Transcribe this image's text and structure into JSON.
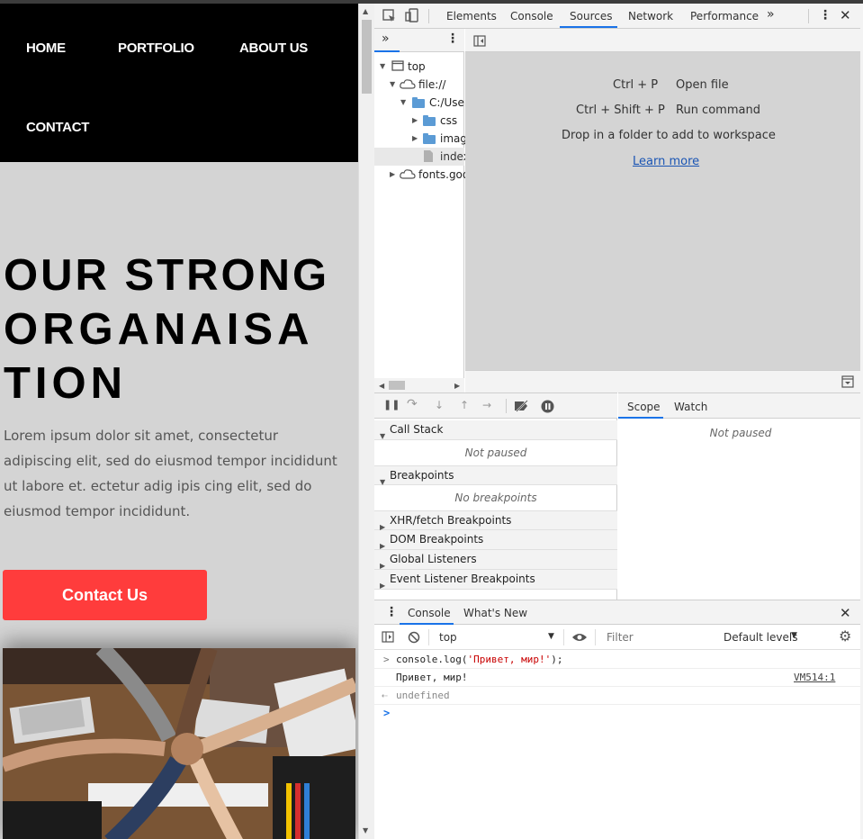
{
  "website": {
    "nav": [
      "HOME",
      "PORTFOLIO",
      "ABOUT US",
      "CONTACT"
    ],
    "hero_title": [
      "OUR STRONG",
      "ORGANAISA",
      "TION"
    ],
    "hero_text": "Lorem ipsum dolor sit amet, consectetur adipiscing elit, sed do eiusmod tempor incididunt ut labore et. ectetur adig ipis cing elit, sed do eiusmod tempor incididunt.",
    "contact_button": "Contact Us"
  },
  "devtools": {
    "tabs": [
      "Elements",
      "Console",
      "Sources",
      "Network",
      "Performance"
    ],
    "active_tab": "Sources",
    "navigator": {
      "tree": [
        {
          "label": "top",
          "depth": 0
        },
        {
          "label": "file://",
          "depth": 1
        },
        {
          "label": "C:/User",
          "depth": 2
        },
        {
          "label": "css",
          "depth": 3
        },
        {
          "label": "imag",
          "depth": 3
        },
        {
          "label": "index",
          "depth": 3
        },
        {
          "label": "fonts.goo",
          "depth": 1
        }
      ]
    },
    "editor": {
      "shortcuts": [
        {
          "keys": "Ctrl + P",
          "action": "Open file"
        },
        {
          "keys": "Ctrl + Shift + P",
          "action": "Run command"
        }
      ],
      "drop_hint": "Drop in a folder to add to workspace",
      "learn_more": "Learn more"
    },
    "debugger": {
      "sections": [
        {
          "label": "Call Stack",
          "note": "Not paused"
        },
        {
          "label": "Breakpoints",
          "note": "No breakpoints"
        },
        {
          "label": "XHR/fetch Breakpoints"
        },
        {
          "label": "DOM Breakpoints"
        },
        {
          "label": "Global Listeners"
        },
        {
          "label": "Event Listener Breakpoints"
        }
      ],
      "scope_tabs": [
        "Scope",
        "Watch"
      ],
      "scope_note": "Not paused"
    },
    "console": {
      "tabs": [
        "Console",
        "What's New"
      ],
      "context": "top",
      "filter_placeholder": "Filter",
      "levels": "Default levels",
      "lines": [
        {
          "pre": "console.log(",
          "str": "'Привет, мир!'",
          "post": ");"
        },
        {
          "text": "Привет, мир!",
          "source": "VM514:1"
        },
        {
          "text": "undefined"
        }
      ]
    }
  },
  "colors": {
    "accent_blue": "#1a73e8",
    "contact_red": "#ff3c3c",
    "string_red": "#c80000"
  }
}
